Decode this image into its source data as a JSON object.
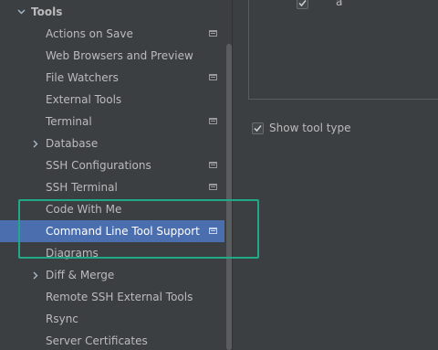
{
  "sidebar": {
    "section_title": "Tools",
    "items": [
      {
        "label": "Actions on Save"
      },
      {
        "label": "Web Browsers and Preview"
      },
      {
        "label": "File Watchers"
      },
      {
        "label": "External Tools"
      },
      {
        "label": "Terminal"
      },
      {
        "label": "Database"
      },
      {
        "label": "SSH Configurations"
      },
      {
        "label": "SSH Terminal"
      },
      {
        "label": "Code With Me"
      },
      {
        "label": "Command Line Tool Support"
      },
      {
        "label": "Diagrams"
      },
      {
        "label": "Diff & Merge"
      },
      {
        "label": "Remote SSH External Tools"
      },
      {
        "label": "Rsync"
      },
      {
        "label": "Server Certificates"
      }
    ]
  },
  "content": {
    "top_checkbox_label": "a",
    "show_tool_type_label": "Show tool type"
  },
  "colors": {
    "sidebar_bg": "#3c3f41",
    "selection": "#4b6eaf",
    "highlight": "#21a888",
    "text": "#bbbbbb"
  }
}
